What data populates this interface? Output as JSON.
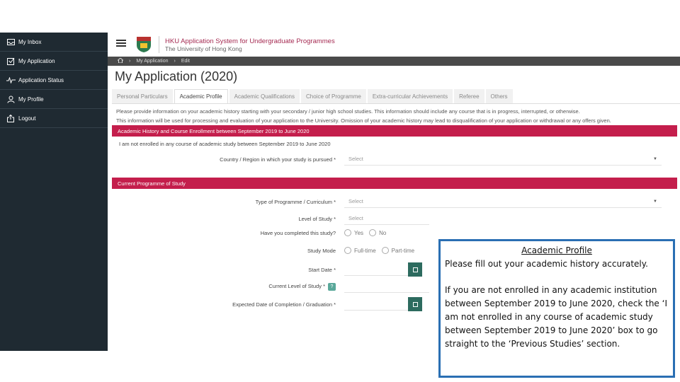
{
  "sidebar": {
    "items": [
      {
        "label": "My Inbox",
        "icon": "inbox-icon"
      },
      {
        "label": "My Application",
        "icon": "checkbox-icon"
      },
      {
        "label": "Application Status",
        "icon": "pulse-icon"
      },
      {
        "label": "My Profile",
        "icon": "user-icon"
      },
      {
        "label": "Logout",
        "icon": "logout-icon"
      }
    ]
  },
  "header": {
    "title": "HKU Application System for Undergraduate Programmes",
    "subtitle": "The University of Hong Kong"
  },
  "breadcrumb": {
    "items": [
      "My Application",
      "Edit"
    ]
  },
  "page": {
    "title": "My Application (2020)"
  },
  "tabs": [
    {
      "label": "Personal Particulars",
      "active": false
    },
    {
      "label": "Academic Profile",
      "active": true
    },
    {
      "label": "Academic Qualifications",
      "active": false
    },
    {
      "label": "Choice of Programme",
      "active": false
    },
    {
      "label": "Extra-curricular Achievements",
      "active": false
    },
    {
      "label": "Referee",
      "active": false
    },
    {
      "label": "Others",
      "active": false
    }
  ],
  "info": {
    "line1": "Please provide information on your academic history starting with your secondary / junior high school studies. This information should include any course that is in progress, interrupted, or otherwise.",
    "line2": "This information will be used for processing and evaluation of your application to the University. Omission of your academic history may lead to disqualification of your application or withdrawal or any offers given."
  },
  "section1": {
    "title": "Academic History and Course Enrollment between September 2019 to June 2020",
    "not_enrolled": "I am not enrolled in any course of academic study between September 2019 to June 2020",
    "country_label": "Country / Region in which your study is pursued *",
    "country_value": "Select"
  },
  "section2": {
    "title": "Current Programme of Study",
    "type_label": "Type of Programme / Curriculum *",
    "type_value": "Select",
    "level_label": "Level of Study *",
    "level_value": "Select",
    "completed_label": "Have you completed this study?",
    "yes": "Yes",
    "no": "No",
    "mode_label": "Study Mode",
    "fulltime": "Full-time",
    "parttime": "Part-time",
    "start_label": "Start Date *",
    "current_level_label": "Current Level of Study *",
    "help": "?",
    "expected_label": "Expected Date of Completion / Graduation *"
  },
  "callout": {
    "title": "Academic Profile",
    "line1": "Please fill out your academic history accurately.",
    "body": "If you are not enrolled in any academic institution between September 2019 to June 2020, check the ‘I am not enrolled in any course of academic study between September 2019 to June 2020’ box to go straight to the ‘Previous Studies’ section."
  },
  "colors": {
    "accent": "#c41e4c",
    "sidebar": "#1f2a32",
    "callout_border": "#2a6fb3"
  }
}
